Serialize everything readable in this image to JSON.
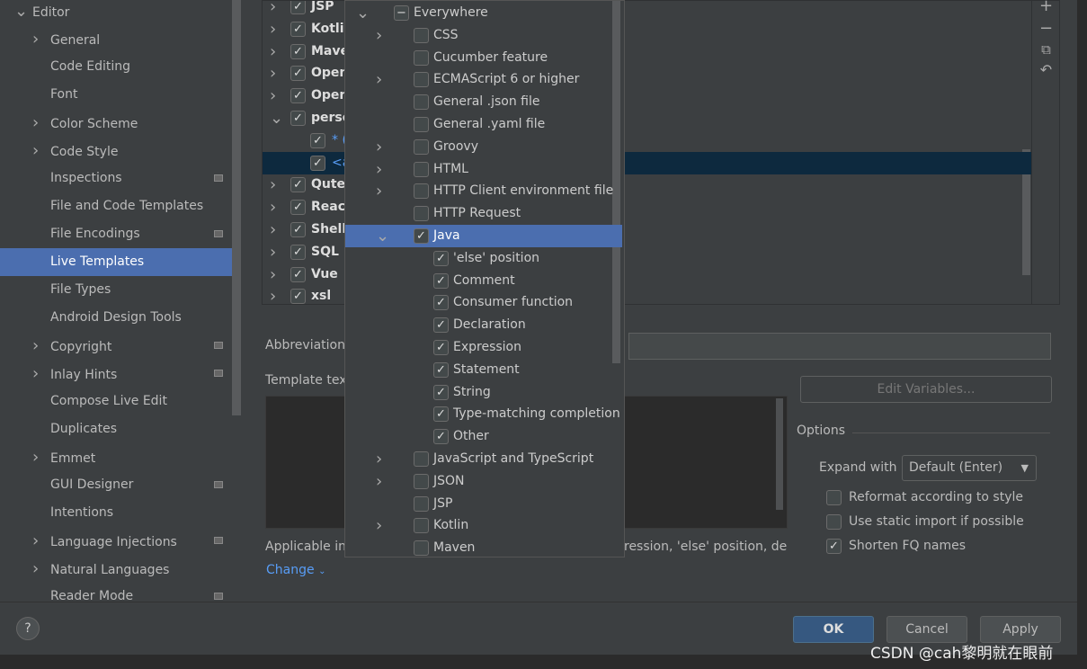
{
  "sidebar": {
    "items": [
      {
        "label": "Editor",
        "chev": "v",
        "indent": 0,
        "badge": false
      },
      {
        "label": "General",
        "chev": ">",
        "indent": 1,
        "badge": false
      },
      {
        "label": "Code Editing",
        "chev": "",
        "indent": 1,
        "badge": false
      },
      {
        "label": "Font",
        "chev": "",
        "indent": 1,
        "badge": false
      },
      {
        "label": "Color Scheme",
        "chev": ">",
        "indent": 1,
        "badge": false
      },
      {
        "label": "Code Style",
        "chev": ">",
        "indent": 1,
        "badge": false
      },
      {
        "label": "Inspections",
        "chev": "",
        "indent": 1,
        "badge": true
      },
      {
        "label": "File and Code Templates",
        "chev": "",
        "indent": 1,
        "badge": false
      },
      {
        "label": "File Encodings",
        "chev": "",
        "indent": 1,
        "badge": true
      },
      {
        "label": "Live Templates",
        "chev": "",
        "indent": 1,
        "badge": false,
        "selected": true
      },
      {
        "label": "File Types",
        "chev": "",
        "indent": 1,
        "badge": false
      },
      {
        "label": "Android Design Tools",
        "chev": "",
        "indent": 1,
        "badge": false
      },
      {
        "label": "Copyright",
        "chev": ">",
        "indent": 1,
        "badge": true
      },
      {
        "label": "Inlay Hints",
        "chev": ">",
        "indent": 1,
        "badge": true
      },
      {
        "label": "Compose Live Edit",
        "chev": "",
        "indent": 1,
        "badge": false
      },
      {
        "label": "Duplicates",
        "chev": "",
        "indent": 1,
        "badge": false
      },
      {
        "label": "Emmet",
        "chev": ">",
        "indent": 1,
        "badge": false
      },
      {
        "label": "GUI Designer",
        "chev": "",
        "indent": 1,
        "badge": true
      },
      {
        "label": "Intentions",
        "chev": "",
        "indent": 1,
        "badge": false
      },
      {
        "label": "Language Injections",
        "chev": ">",
        "indent": 1,
        "badge": true
      },
      {
        "label": "Natural Languages",
        "chev": ">",
        "indent": 1,
        "badge": false
      },
      {
        "label": "Reader Mode",
        "chev": "",
        "indent": 1,
        "badge": true
      }
    ]
  },
  "tree": {
    "rows": [
      {
        "label": "JSP",
        "chev": ">",
        "level": 0
      },
      {
        "label": "Kotlin",
        "chev": ">",
        "level": 0
      },
      {
        "label": "Maven",
        "chev": ">",
        "level": 0
      },
      {
        "label": "Open",
        "chev": ">",
        "level": 0
      },
      {
        "label": "Open",
        "chev": ">",
        "level": 0
      },
      {
        "label": "perso",
        "chev": "v",
        "level": 0
      },
      {
        "label": "* (",
        "chev": "",
        "level": 1
      },
      {
        "label": "<a",
        "chev": "",
        "level": 1,
        "selected": true
      },
      {
        "label": "Qute",
        "chev": ">",
        "level": 0
      },
      {
        "label": "React",
        "chev": ">",
        "level": 0
      },
      {
        "label": "Shell",
        "chev": ">",
        "level": 0
      },
      {
        "label": "SQL",
        "chev": ">",
        "level": 0
      },
      {
        "label": "Vue",
        "chev": ">",
        "level": 0
      },
      {
        "label": "xsl",
        "chev": ">",
        "level": 0
      }
    ],
    "tools": [
      "add-icon",
      "remove-icon",
      "copy-icon",
      "revert-icon"
    ]
  },
  "popup": {
    "rows": [
      {
        "label": "Everywhere",
        "chev": "v",
        "level": 0,
        "state": "partial"
      },
      {
        "label": "CSS",
        "chev": ">",
        "level": 1,
        "state": "off"
      },
      {
        "label": "Cucumber feature",
        "chev": "",
        "level": 1,
        "state": "off"
      },
      {
        "label": "ECMAScript 6 or higher",
        "chev": ">",
        "level": 1,
        "state": "off"
      },
      {
        "label": "General .json file",
        "chev": "",
        "level": 1,
        "state": "off"
      },
      {
        "label": "General .yaml file",
        "chev": "",
        "level": 1,
        "state": "off"
      },
      {
        "label": "Groovy",
        "chev": ">",
        "level": 1,
        "state": "off"
      },
      {
        "label": "HTML",
        "chev": ">",
        "level": 1,
        "state": "off"
      },
      {
        "label": "HTTP Client environment file",
        "chev": ">",
        "level": 1,
        "state": "off"
      },
      {
        "label": "HTTP Request",
        "chev": "",
        "level": 1,
        "state": "off"
      },
      {
        "label": "Java",
        "chev": "v",
        "level": 1,
        "state": "on",
        "selected": true
      },
      {
        "label": "'else' position",
        "chev": "",
        "level": 2,
        "state": "on"
      },
      {
        "label": "Comment",
        "chev": "",
        "level": 2,
        "state": "on"
      },
      {
        "label": "Consumer function",
        "chev": "",
        "level": 2,
        "state": "on"
      },
      {
        "label": "Declaration",
        "chev": "",
        "level": 2,
        "state": "on"
      },
      {
        "label": "Expression",
        "chev": "",
        "level": 2,
        "state": "on"
      },
      {
        "label": "Statement",
        "chev": "",
        "level": 2,
        "state": "on"
      },
      {
        "label": "String",
        "chev": "",
        "level": 2,
        "state": "on"
      },
      {
        "label": "Type-matching completion",
        "chev": "",
        "level": 2,
        "state": "on"
      },
      {
        "label": "Other",
        "chev": "",
        "level": 2,
        "state": "on"
      },
      {
        "label": "JavaScript and TypeScript",
        "chev": ">",
        "level": 1,
        "state": "off"
      },
      {
        "label": "JSON",
        "chev": ">",
        "level": 1,
        "state": "off"
      },
      {
        "label": "JSP",
        "chev": "",
        "level": 1,
        "state": "off"
      },
      {
        "label": "Kotlin",
        "chev": ">",
        "level": 1,
        "state": "off"
      },
      {
        "label": "Maven",
        "chev": "",
        "level": 1,
        "state": "off"
      }
    ]
  },
  "form": {
    "abbreviation_label": "Abbreviation",
    "template_text_label": "Template tex",
    "edit_variables": "Edit Variables...",
    "applicable_label": "Applicable in",
    "applicable_tail": "ression, 'else' position, decl",
    "change_link": "Change",
    "options_title": "Options",
    "expand_with_label": "Expand with",
    "expand_with_value": "Default (Enter)",
    "reformat": "Reformat according to style",
    "static_import": "Use static import if possible",
    "shorten_fq": "Shorten FQ names",
    "reformat_checked": false,
    "static_import_checked": false,
    "shorten_fq_checked": true
  },
  "footer": {
    "help": "?",
    "ok": "OK",
    "cancel": "Cancel",
    "apply": "Apply"
  },
  "watermark": "CSDN @cah黎明就在眼前",
  "colors": {
    "selection": "#4b6eaf",
    "tree_selection": "#0d293e",
    "link": "#589df6",
    "ok": "#365880"
  }
}
